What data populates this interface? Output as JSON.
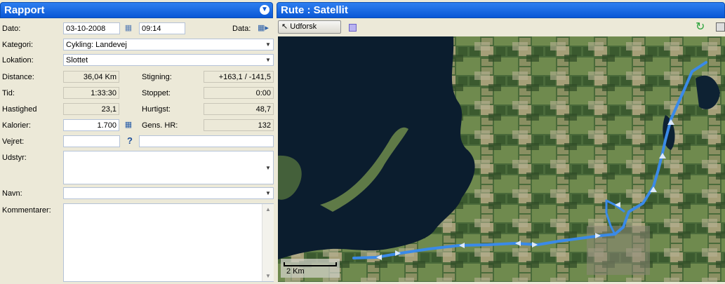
{
  "left_panel": {
    "title": "Rapport",
    "collapse_icon": "chevron-down-circle-icon",
    "labels": {
      "date": "Dato:",
      "data": "Data:",
      "category": "Kategori:",
      "location": "Lokation:",
      "distance": "Distance:",
      "ascent": "Stigning:",
      "time": "Tid:",
      "stopped": "Stoppet:",
      "speed": "Hastighed",
      "fastest": "Hurtigst:",
      "calories": "Kalorier:",
      "avg_hr": "Gens. HR:",
      "weather": "Vejret:",
      "equipment": "Udstyr:",
      "name": "Navn:",
      "comments": "Kommentarer:"
    },
    "values": {
      "date": "03-10-2008",
      "time_of_day": "09:14",
      "category": "Cykling: Landevej",
      "location": "Slottet",
      "distance": "36,04 Km",
      "ascent": "+163,1 / -141,5",
      "duration": "1:33:30",
      "stopped": "0:00",
      "speed": "23,1",
      "fastest": "48,7",
      "calories": "1.700",
      "avg_hr": "132",
      "weather": "",
      "weather_note": "",
      "equipment": "",
      "name": "",
      "comments": ""
    }
  },
  "right_panel": {
    "title": "Rute : Satellit",
    "explore_button": "Udforsk",
    "scale_label": "2 Km",
    "route_color": "#3a8ae8"
  },
  "icons": [
    "calendar-icon",
    "data-options-icon",
    "calculator-icon",
    "help-icon",
    "cursor-arrow-icon",
    "square-icon",
    "refresh-icon",
    "save-icon"
  ]
}
